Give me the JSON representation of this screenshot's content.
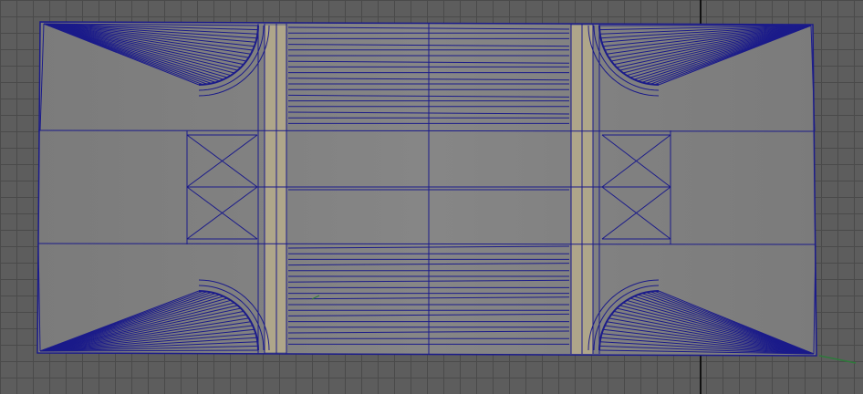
{
  "viewport": {
    "view": "top-orthographic",
    "shading": "smooth-shaded-with-wireframe",
    "grid_visible": true
  },
  "mesh": {
    "object": "road-intersection-plane",
    "selected": true
  },
  "colors": {
    "background": "#5d5d5d",
    "grid_line": "#4a4a4a",
    "grid_axis": "#111111",
    "surface": "#7a7a7a",
    "surface_light": "#838383",
    "wireframe": "#1b1b8a",
    "crosswalk": "#b7ad8c",
    "pivot_green": "#2d7a3a"
  }
}
